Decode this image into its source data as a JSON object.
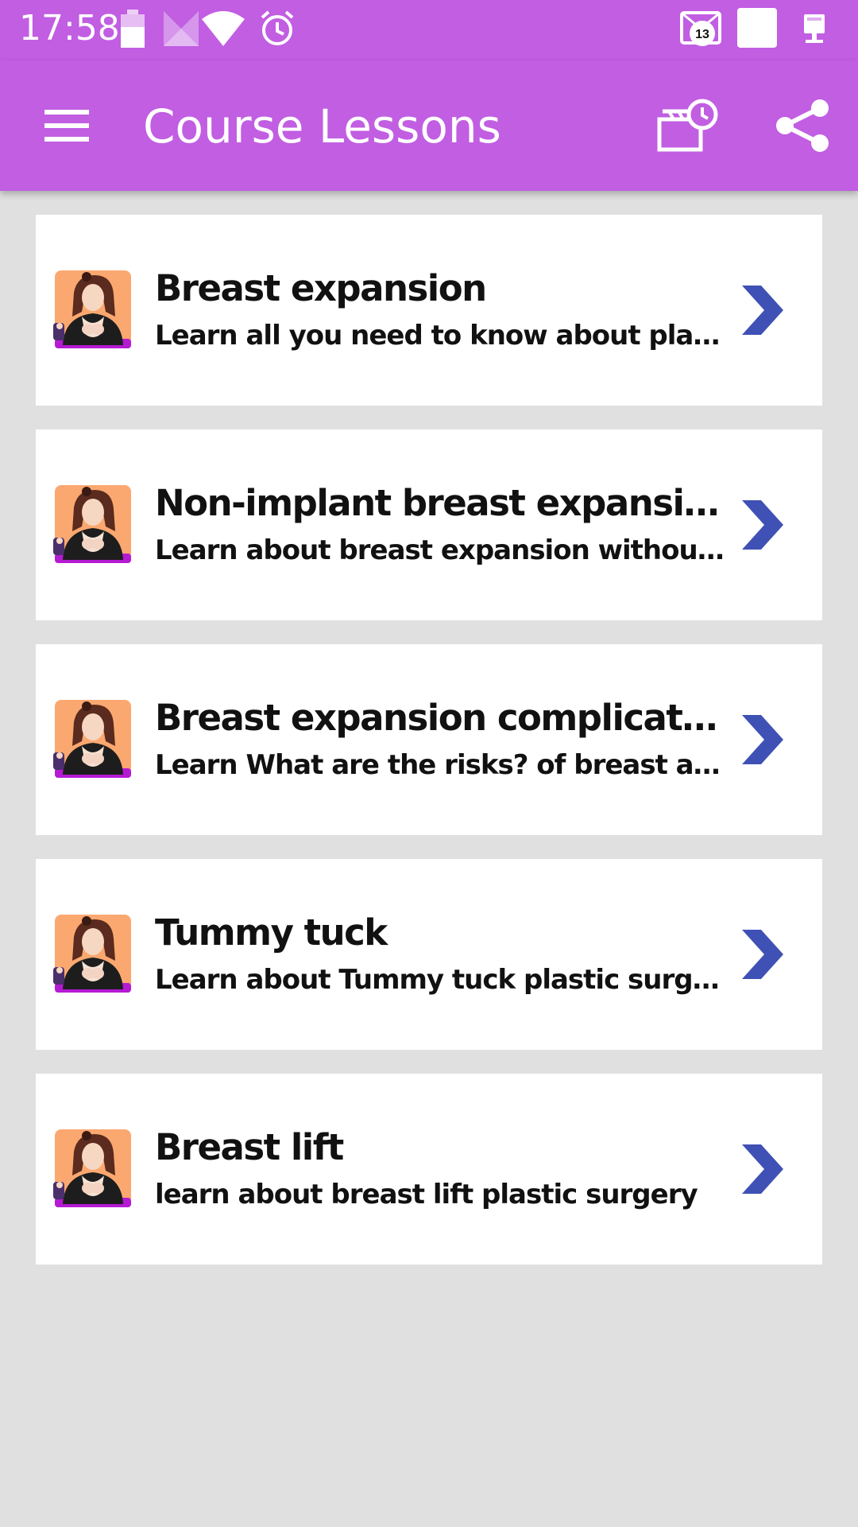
{
  "status_bar": {
    "time": "17:58",
    "notification_count": "13",
    "icons": [
      "battery-icon",
      "signal-icon",
      "wifi-icon",
      "alarm-icon",
      "notification-badge-icon",
      "blank-notification-icon",
      "ethernet-icon"
    ]
  },
  "app_bar": {
    "title": "Course Lessons",
    "menu_icon": "hamburger-menu-icon",
    "actions": [
      "schedule-icon",
      "share-icon"
    ]
  },
  "lessons": [
    {
      "title": "Breast expansion",
      "description": "Learn all you need to know about plastic surgery"
    },
    {
      "title": "Non-implant breast expansion",
      "description": "Learn about breast expansion without the use of implants"
    },
    {
      "title": "Breast expansion complications and risks",
      "description": "Learn What are the risks? of breast augmentation"
    },
    {
      "title": "Tummy tuck",
      "description": "Learn about Tummy tuck plastic surgery"
    },
    {
      "title": "Breast lift",
      "description": "learn about breast lift plastic surgery"
    }
  ],
  "colors": {
    "primary": "#c15ee2",
    "background": "#e0e0e0",
    "card": "#ffffff",
    "chevron": "#3f51b5"
  }
}
